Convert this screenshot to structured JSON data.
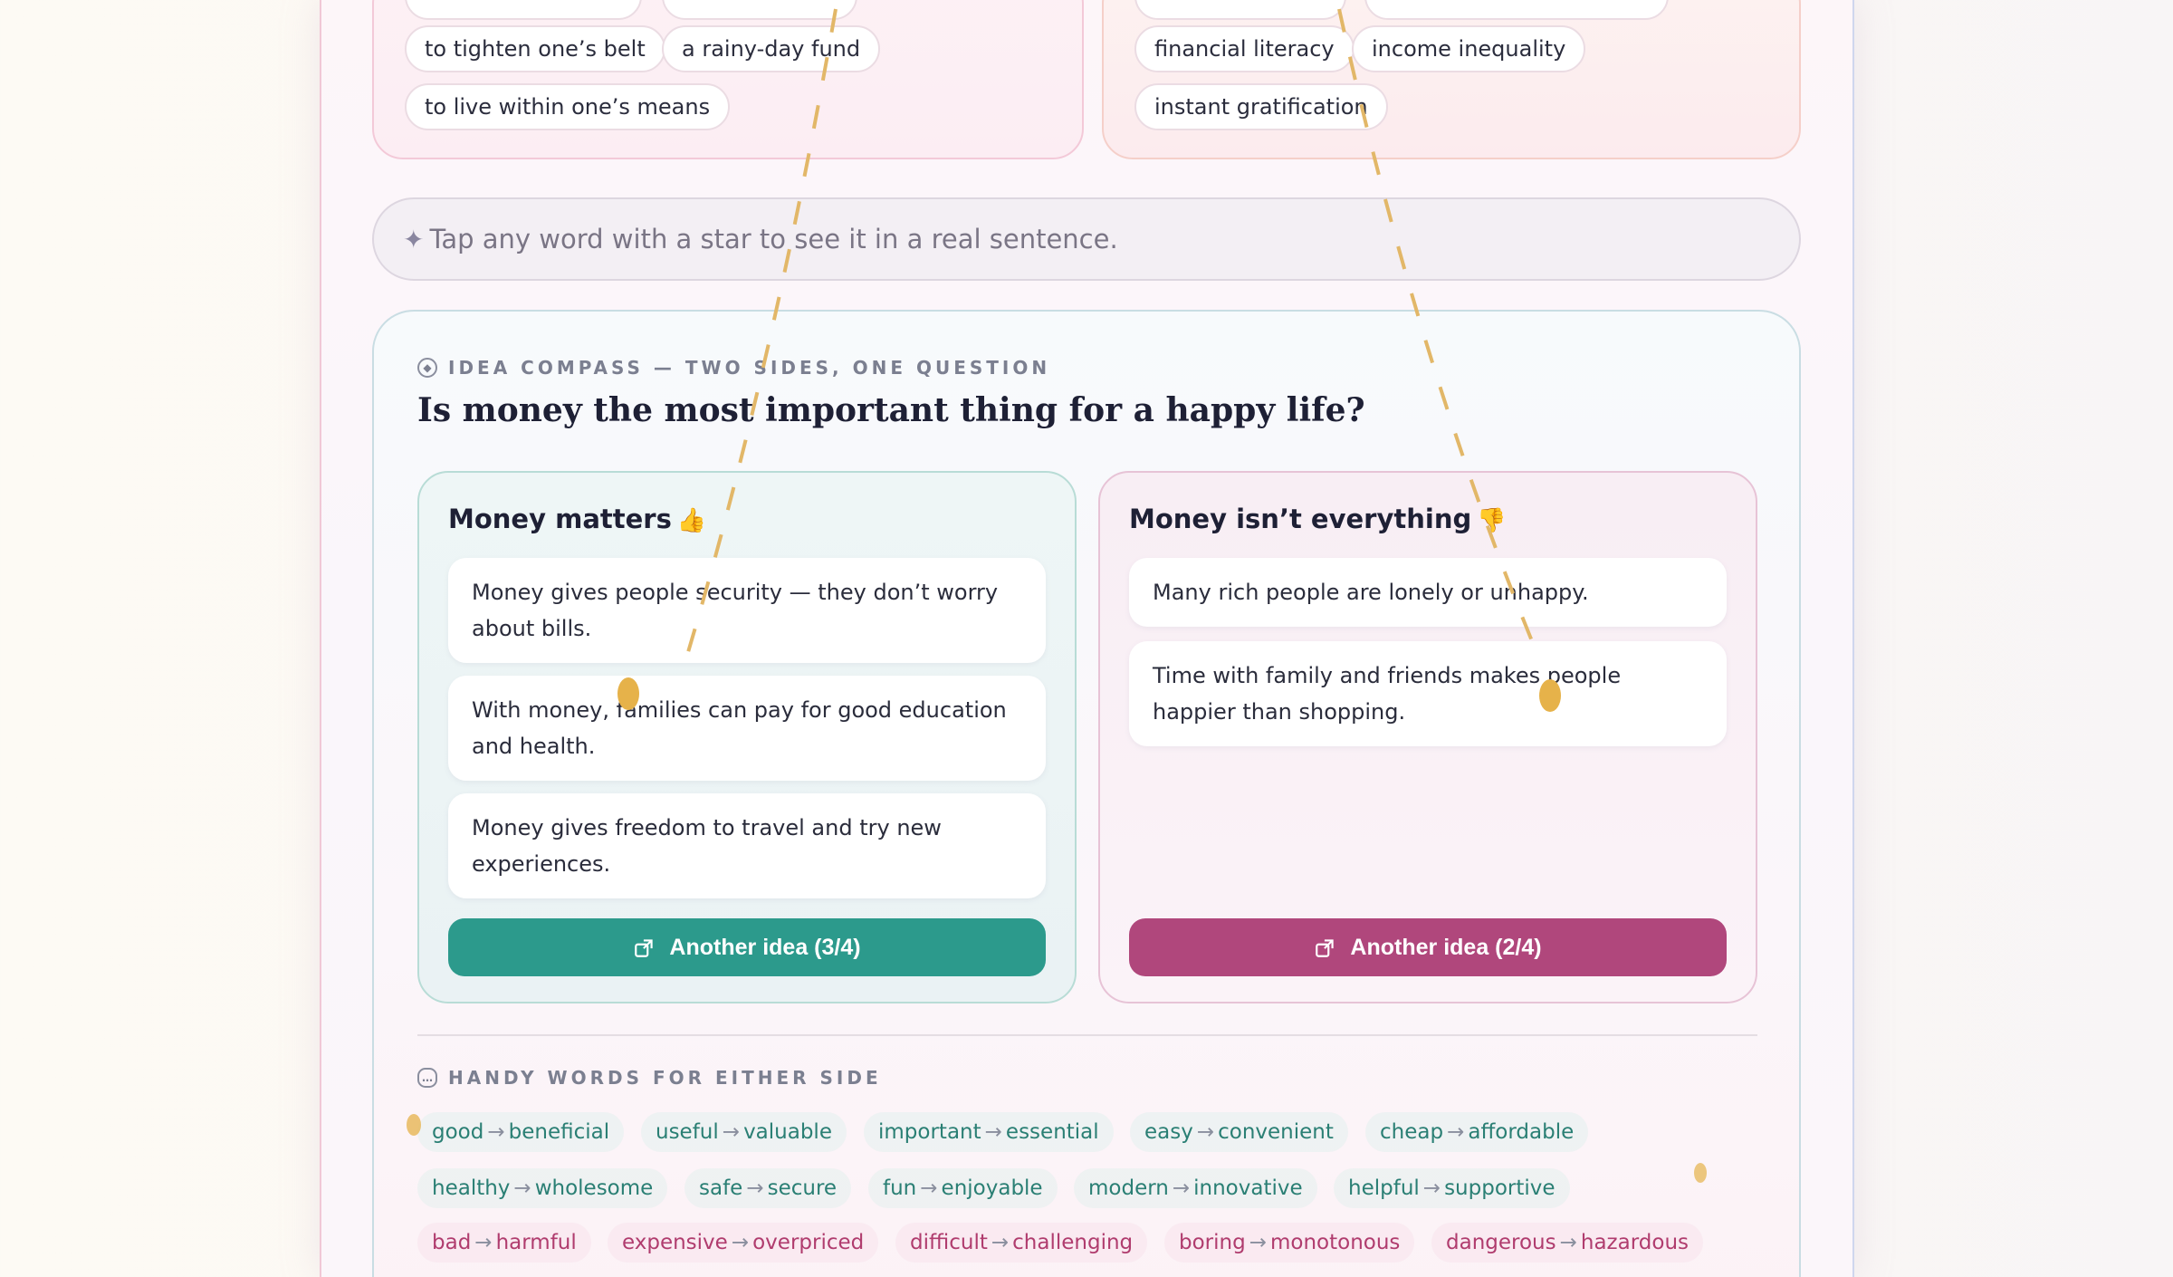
{
  "top_cards": {
    "left_chips": [
      "to tighten one’s belt",
      "a rainy-day fund",
      "to live within one’s means"
    ],
    "right_chips": [
      "financial literacy",
      "income inequality",
      "instant gratification"
    ]
  },
  "hint": {
    "icon": "sparkle-icon",
    "text": "Tap any word with a star to see it in a real sentence."
  },
  "compass": {
    "eyebrow": "IDEA COMPASS — TWO SIDES, ONE QUESTION",
    "question": "Is money the most important thing for a happy life?",
    "pro": {
      "title": "Money matters",
      "emoji": "👍",
      "ideas": [
        "Money gives people security — they don’t worry about bills.",
        "With money, families can pay for good education and health.",
        "Money gives freedom to travel and try new experiences."
      ],
      "button": "Another idea (3/4)"
    },
    "con": {
      "title": "Money isn’t everything",
      "emoji": "👎",
      "ideas": [
        "Many rich people are lonely or unhappy.",
        "Time with family and friends makes people happier than shopping."
      ],
      "button": "Another idea (2/4)"
    }
  },
  "handy_words": {
    "eyebrow": "HANDY WORDS FOR EITHER SIDE",
    "positive": [
      [
        "good",
        "beneficial"
      ],
      [
        "useful",
        "valuable"
      ],
      [
        "important",
        "essential"
      ],
      [
        "easy",
        "convenient"
      ],
      [
        "cheap",
        "affordable"
      ],
      [
        "healthy",
        "wholesome"
      ],
      [
        "safe",
        "secure"
      ],
      [
        "fun",
        "enjoyable"
      ],
      [
        "modern",
        "innovative"
      ],
      [
        "helpful",
        "supportive"
      ]
    ],
    "negative": [
      [
        "bad",
        "harmful"
      ],
      [
        "expensive",
        "overpriced"
      ],
      [
        "difficult",
        "challenging"
      ],
      [
        "boring",
        "monotonous"
      ],
      [
        "dangerous",
        "hazardous"
      ]
    ]
  },
  "colors": {
    "pro_button": "#2c9a8c",
    "con_button": "#b0477c",
    "confetti": "#e6b24a"
  }
}
